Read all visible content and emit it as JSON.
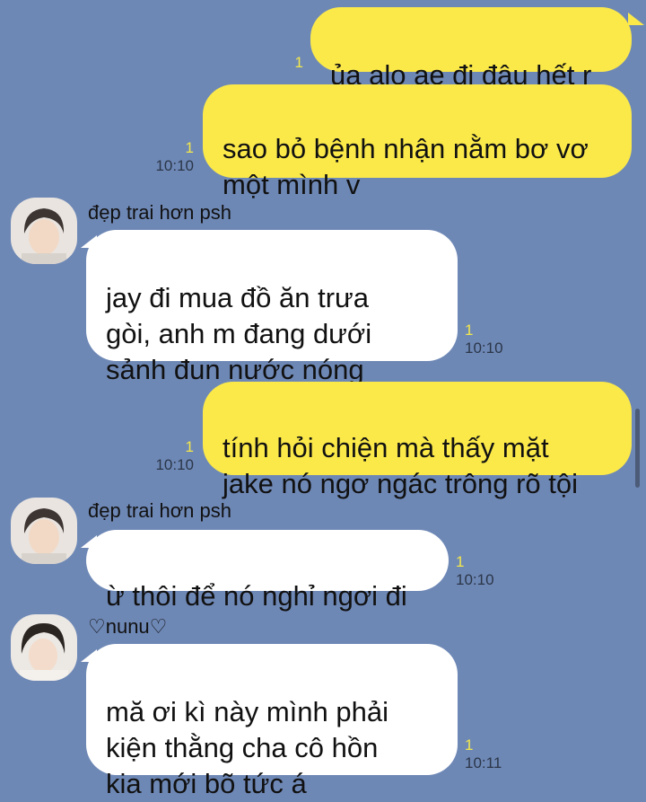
{
  "chat": {
    "messages": [
      {
        "side": "out",
        "text": "ủa alo ae đi đâu hết r",
        "read": "1",
        "time": ""
      },
      {
        "side": "out",
        "text": "sao bỏ bệnh nhận nằm bơ vơ\nmột mình v",
        "read": "1",
        "time": "10:10"
      },
      {
        "side": "in",
        "sender": "đẹp trai hơn psh",
        "text": "jay đi mua đồ ăn trưa\ngòi, anh m đang dưới\nsảnh đun nước nóng",
        "read": "1",
        "time": "10:10"
      },
      {
        "side": "out",
        "text": "tính hỏi chiện mà thấy mặt\njake nó ngơ ngác trông rõ tội",
        "read": "1",
        "time": "10:10"
      },
      {
        "side": "in",
        "sender": "đẹp trai hơn psh",
        "text": "ừ thôi để nó nghỉ ngơi đi",
        "read": "1",
        "time": "10:10"
      },
      {
        "side": "in",
        "sender": "♡nunu♡",
        "text": "mă ơi kì này mình phải\nkiện thằng cha cô hồn\nkia mới bõ tức á",
        "read": "1",
        "time": "10:11"
      }
    ]
  },
  "colors": {
    "background": "#6e88b6",
    "outgoing_bubble": "#fbe94a",
    "incoming_bubble": "#ffffff",
    "read_count": "#f3e74a"
  }
}
